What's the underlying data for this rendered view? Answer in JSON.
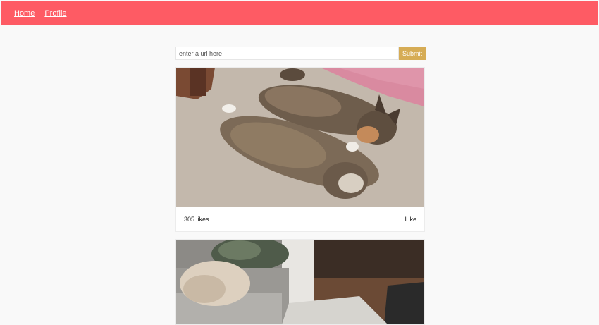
{
  "nav": {
    "home_label": "Home",
    "profile_label": "Profile"
  },
  "form": {
    "placeholder": "enter a url here",
    "submit_label": "Submit"
  },
  "posts": [
    {
      "likes_label": "305 likes",
      "like_button_label": "Like"
    }
  ],
  "colors": {
    "navbar": "#fe5b64",
    "submit_button": "#d6ac55",
    "page_background": "#f9f9f9"
  }
}
